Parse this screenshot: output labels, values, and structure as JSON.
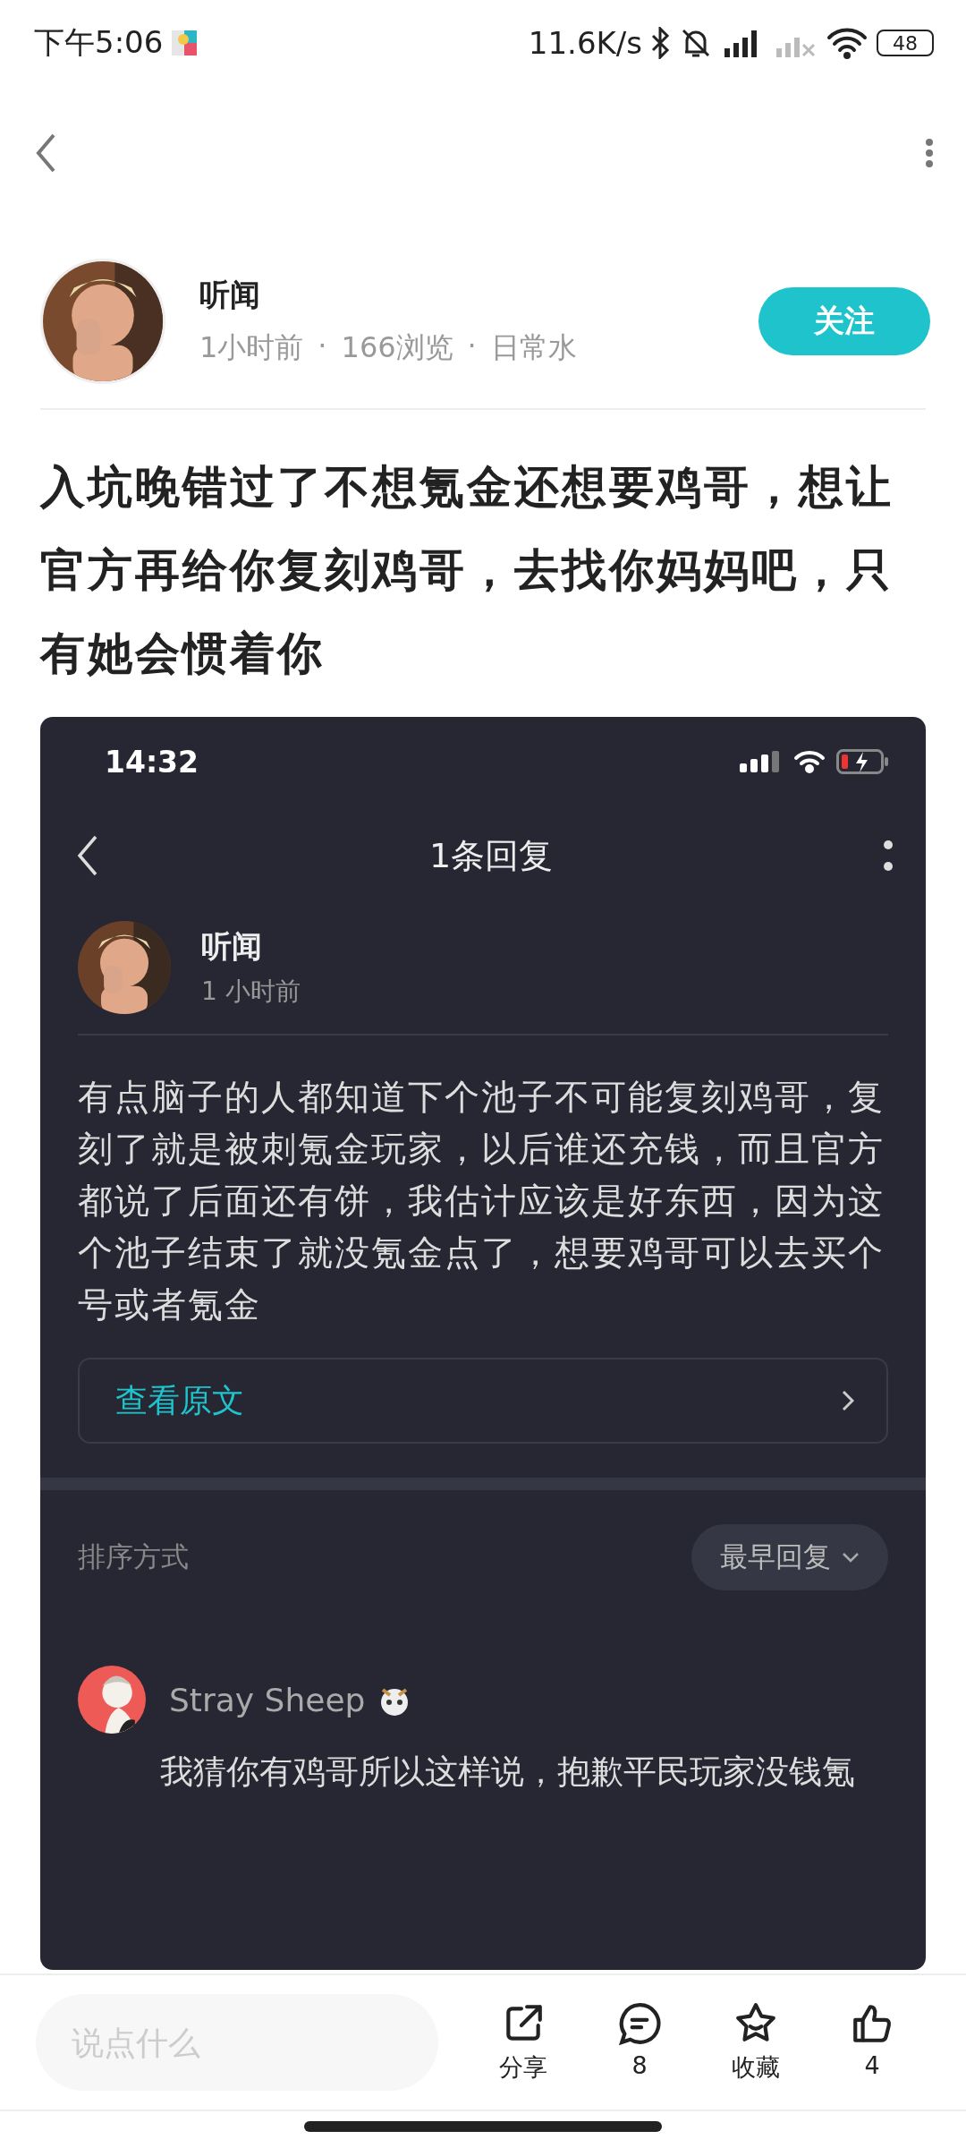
{
  "status_bar": {
    "time": "下午5:06",
    "network_speed": "11.6K/s",
    "battery": "48"
  },
  "post": {
    "author": {
      "name": "听闻",
      "meta": [
        "1小时前",
        "166浏览",
        "日常水"
      ],
      "separator": "·",
      "follow_button": "关注"
    },
    "title": "入坑晚错过了不想氪金还想要鸡哥，想让官方再给你复刻鸡哥，去找你妈妈吧，只有她会惯着你",
    "screenshot": {
      "status_bar": {
        "time": "14:32"
      },
      "nav_title": "1条回复",
      "author": {
        "name": "听闻",
        "time": "1 小时前"
      },
      "body": "有点脑子的人都知道下个池子不可能复刻鸡哥，复刻了就是被刺氪金玩家，以后谁还充钱，而且官方都说了后面还有饼，我估计应该是好东西，因为这个池子结束了就没氪金点了，想要鸡哥可以去买个号或者氪金",
      "view_original": "查看原文",
      "sort_label": "排序方式",
      "sort_value": "最早回复",
      "reply": {
        "name": "Stray Sheep",
        "text": "我猜你有鸡哥所以这样说，抱歉平民玩家没钱氪"
      }
    }
  },
  "bottom_bar": {
    "comment_placeholder": "说点什么",
    "actions": [
      {
        "kind": "share",
        "label": "分享"
      },
      {
        "kind": "comment",
        "label": "8"
      },
      {
        "kind": "favorite",
        "label": "收藏"
      },
      {
        "kind": "like",
        "label": "4"
      }
    ]
  }
}
